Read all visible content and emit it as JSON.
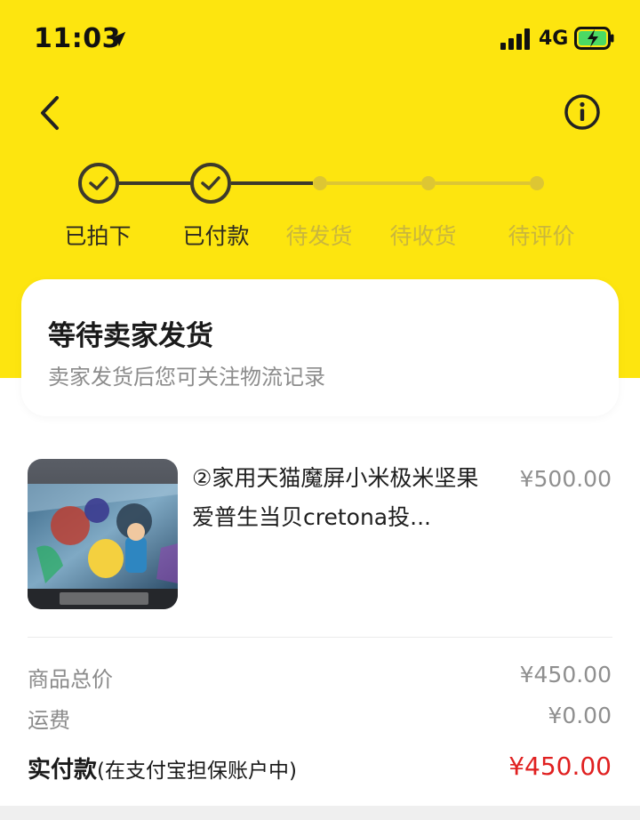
{
  "status_bar": {
    "time": "11:03",
    "network": "4G"
  },
  "nav": {
    "back_icon": "chevron-left",
    "info_icon": "info-circle"
  },
  "colors": {
    "header_bg": "#fde50f",
    "done": "#3d3a2b",
    "pending": "#ddc633",
    "price_red": "#e02020"
  },
  "steps": [
    {
      "label": "已拍下",
      "state": "done"
    },
    {
      "label": "已付款",
      "state": "done"
    },
    {
      "label": "待发货",
      "state": "pending"
    },
    {
      "label": "待收货",
      "state": "pending"
    },
    {
      "label": "待评价",
      "state": "pending"
    }
  ],
  "order_status": {
    "title": "等待卖家发货",
    "subtitle": "卖家发货后您可关注物流记录"
  },
  "product": {
    "title": "②家用天猫魔屏小米极米坚果爱普生当贝cretona投...",
    "price": "¥500.00"
  },
  "summary": {
    "goods_total_label": "商品总价",
    "goods_total_value": "¥450.00",
    "shipping_label": "运费",
    "shipping_value": "¥0.00",
    "paid_label": "实付款",
    "paid_note": "(在支付宝担保账户中)",
    "paid_value": "¥450.00"
  }
}
